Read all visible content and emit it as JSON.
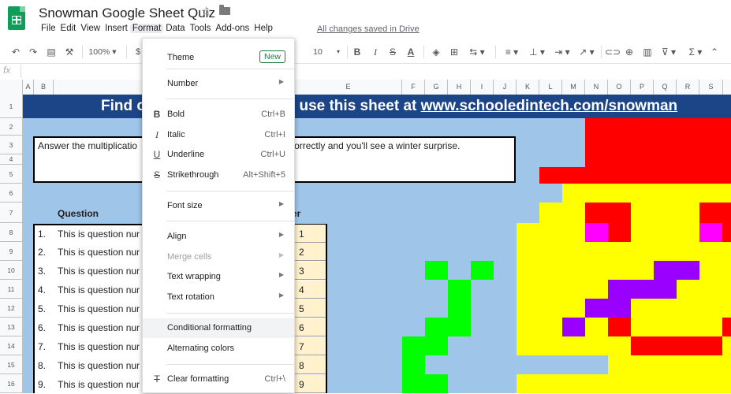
{
  "header": {
    "title": "Snowman Google Sheet Quiz",
    "save_status": "All changes saved in Drive"
  },
  "menubar": [
    "File",
    "Edit",
    "View",
    "Insert",
    "Format",
    "Data",
    "Tools",
    "Add-ons",
    "Help"
  ],
  "toolbar": {
    "zoom": "100%",
    "currency": "$",
    "font_size": "10"
  },
  "formula_bar": {
    "fx_label": "fx",
    "value": ""
  },
  "columns": [
    "A",
    "B",
    "E",
    "F",
    "G",
    "H",
    "I",
    "J",
    "K",
    "L",
    "M",
    "N",
    "O",
    "P",
    "Q",
    "R",
    "S"
  ],
  "rows": [
    "1",
    "2",
    "3",
    "4",
    "5",
    "6",
    "7",
    "8",
    "9",
    "10",
    "11",
    "12",
    "13",
    "14",
    "15",
    "16"
  ],
  "sheet": {
    "banner": "Find o",
    "banner_tail": "how to use this sheet at ",
    "banner_link": "www.schooledintech.com/snowman",
    "instructions_a": "Answer the multiplicatio",
    "instructions_b": "correctly and you'll see a winter surprise.",
    "question_header": "Question",
    "answer_header": "er",
    "questions": [
      {
        "num": "1.",
        "text": "This is question nur",
        "answer": "1"
      },
      {
        "num": "2.",
        "text": "This is question nur",
        "answer": "2"
      },
      {
        "num": "3.",
        "text": "This is question nur",
        "answer": "3"
      },
      {
        "num": "4.",
        "text": "This is question nur",
        "answer": "4"
      },
      {
        "num": "5.",
        "text": "This is question nur",
        "answer": "5"
      },
      {
        "num": "6.",
        "text": "This is question nur",
        "answer": "6"
      },
      {
        "num": "7.",
        "text": "This is question nur",
        "answer": "7"
      },
      {
        "num": "8.",
        "text": "This is question nur",
        "answer": "8"
      },
      {
        "num": "9.",
        "text": "This is question nur",
        "answer": "9"
      }
    ]
  },
  "format_menu": {
    "new_badge": "New",
    "items": [
      {
        "label": "Theme"
      },
      {
        "label": "Number"
      },
      {
        "label": "Bold",
        "shortcut": "Ctrl+B",
        "icon": "bold-icon"
      },
      {
        "label": "Italic",
        "shortcut": "Ctrl+I",
        "icon": "italic-icon"
      },
      {
        "label": "Underline",
        "shortcut": "Ctrl+U",
        "icon": "underline-icon"
      },
      {
        "label": "Strikethrough",
        "shortcut": "Alt+Shift+5",
        "icon": "strikethrough-icon"
      },
      {
        "label": "Font size"
      },
      {
        "label": "Align"
      },
      {
        "label": "Merge cells",
        "disabled": true
      },
      {
        "label": "Text wrapping"
      },
      {
        "label": "Text rotation"
      },
      {
        "label": "Conditional formatting"
      },
      {
        "label": "Alternating colors"
      },
      {
        "label": "Clear formatting",
        "shortcut": "Ctrl+\\",
        "icon": "clear-formatting-icon"
      }
    ]
  },
  "colors": {
    "banner": "#1c4587",
    "sheet_bg": "#9fc5e8",
    "hat_red": "#ff0000",
    "face_yellow": "#ffff00",
    "scarf_purple": "#9900ff",
    "eye_magenta": "#ff00ff",
    "tree_green": "#00ff00",
    "answer_fill": "#fff2cc",
    "new_badge": "#188038"
  }
}
